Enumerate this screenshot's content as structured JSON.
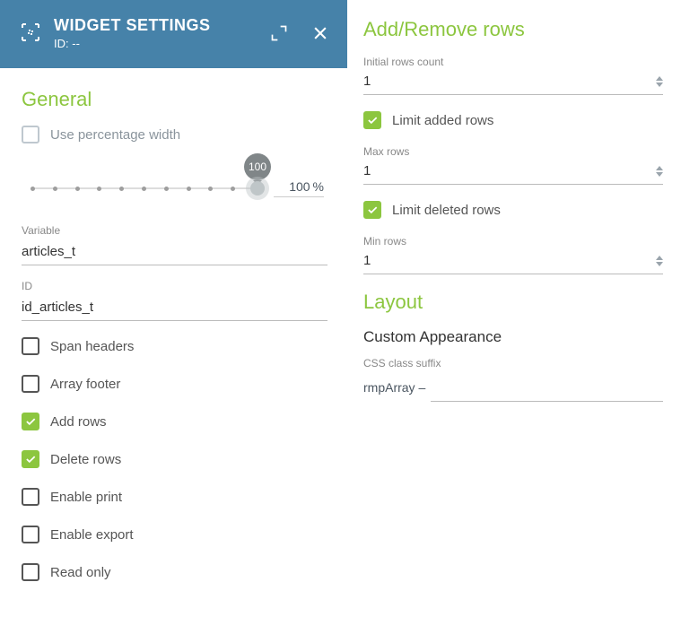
{
  "header": {
    "title": "WIDGET SETTINGS",
    "id_label": "ID:",
    "id_value": "--"
  },
  "general": {
    "section_title": "General",
    "use_percentage_label": "Use percentage width",
    "slider_tooltip": "100",
    "percent_value": "100",
    "percent_suffix": "%",
    "variable_label": "Variable",
    "variable_value": "articles_t",
    "id_label": "ID",
    "id_value": "id_articles_t",
    "options": [
      {
        "label": "Span headers",
        "checked": false
      },
      {
        "label": "Array footer",
        "checked": false
      },
      {
        "label": "Add rows",
        "checked": true
      },
      {
        "label": "Delete rows",
        "checked": true
      },
      {
        "label": "Enable print",
        "checked": false
      },
      {
        "label": "Enable export",
        "checked": false
      },
      {
        "label": "Read only",
        "checked": false
      }
    ]
  },
  "addremove": {
    "section_title": "Add/Remove rows",
    "initial_label": "Initial rows count",
    "initial_value": "1",
    "limit_added_label": "Limit added rows",
    "max_label": "Max rows",
    "max_value": "1",
    "limit_deleted_label": "Limit deleted rows",
    "min_label": "Min rows",
    "min_value": "1"
  },
  "layout": {
    "section_title": "Layout",
    "custom_appearance": "Custom Appearance",
    "css_label": "CSS class suffix",
    "css_prefix": "rmpArray –",
    "css_value": ""
  }
}
